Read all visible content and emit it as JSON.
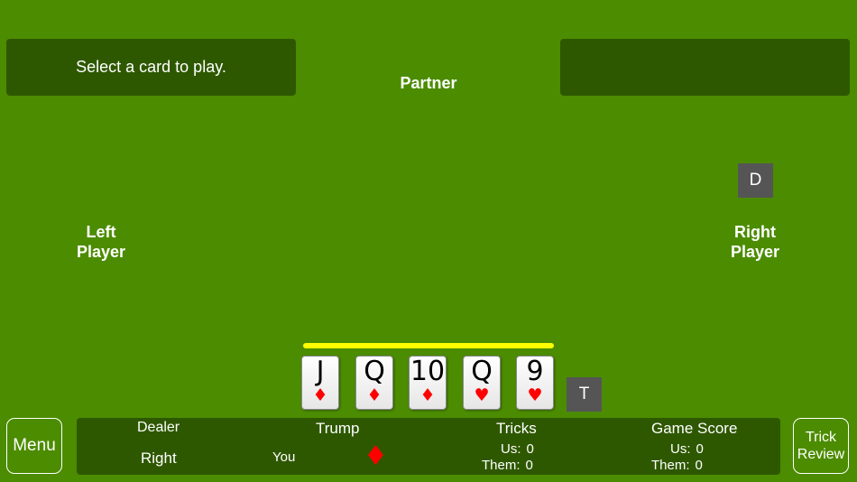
{
  "message": "Select a card to play.",
  "players": {
    "partner": "Partner",
    "left": [
      "Left",
      "Player"
    ],
    "right": [
      "Right",
      "Player"
    ]
  },
  "chips": {
    "dealer": "D",
    "trump": "T"
  },
  "hand": [
    {
      "rank": "J",
      "suit": "♦"
    },
    {
      "rank": "Q",
      "suit": "♦"
    },
    {
      "rank": "10",
      "suit": "♦"
    },
    {
      "rank": "Q",
      "suit": "♥"
    },
    {
      "rank": "9",
      "suit": "♥"
    }
  ],
  "buttons": {
    "menu": "Menu",
    "trick_review": [
      "Trick",
      "Review"
    ]
  },
  "status": {
    "dealer_heading": "Dealer",
    "dealer_value": "Right",
    "trump_heading": "Trump",
    "trump_caller": "You",
    "trump_suit": "♦",
    "tricks_heading": "Tricks",
    "tricks_us_label": "Us:",
    "tricks_us_value": "0",
    "tricks_them_label": "Them:",
    "tricks_them_value": "0",
    "score_heading": "Game Score",
    "score_us_label": "Us:",
    "score_us_value": "0",
    "score_them_label": "Them:",
    "score_them_value": "0"
  },
  "colors": {
    "table": "#4c8c00",
    "panel": "#2e5800",
    "turn_indicator": "#ffff00",
    "red_suit": "#ff0000",
    "chip": "#555555"
  }
}
